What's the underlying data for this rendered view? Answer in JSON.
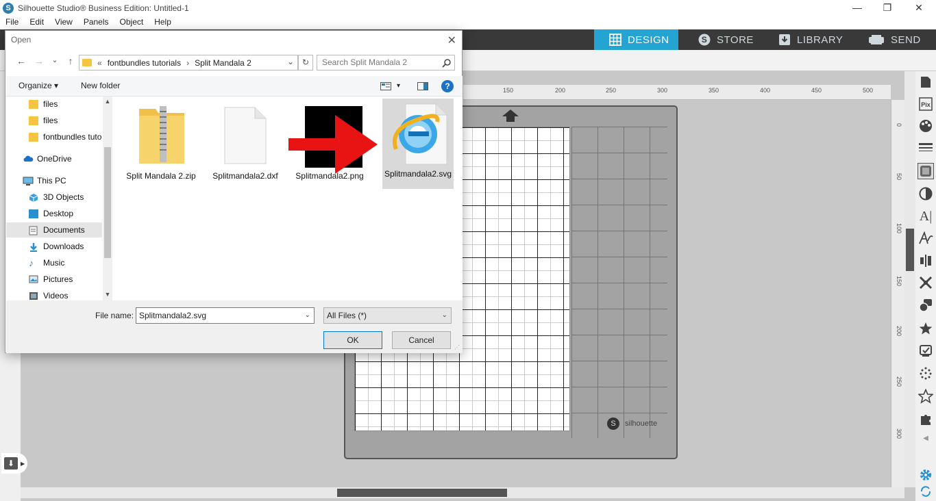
{
  "window": {
    "title": "Silhouette Studio® Business Edition: Untitled-1",
    "logo_text": "S",
    "controls": [
      "—",
      "❐",
      "✕"
    ]
  },
  "menu": [
    "File",
    "Edit",
    "View",
    "Panels",
    "Object",
    "Help"
  ],
  "nav_tabs": [
    {
      "label": "DESIGN",
      "icon": "grid-icon",
      "active": true
    },
    {
      "label": "STORE",
      "icon": "silhouette-s-icon",
      "active": false
    },
    {
      "label": "LIBRARY",
      "icon": "library-download-icon",
      "active": false
    },
    {
      "label": "SEND",
      "icon": "cutter-send-icon",
      "active": false
    }
  ],
  "ruler": {
    "h_ticks": [
      "150",
      "200",
      "250",
      "300",
      "350",
      "400",
      "450",
      "500"
    ],
    "v_ticks": [
      "0",
      "50",
      "100",
      "150",
      "200",
      "250",
      "300"
    ]
  },
  "mat": {
    "brand": "silhouette",
    "brand_logo": "S"
  },
  "dialog": {
    "title": "Open",
    "close": "✕",
    "nav_buttons": [
      "←",
      "→",
      "⌄",
      "↑"
    ],
    "breadcrumb": {
      "overflow": "«",
      "parent": "fontbundles tutorials",
      "sep": "›",
      "current": "Split Mandala 2",
      "dropdown": "⌄"
    },
    "refresh": "↻",
    "search_placeholder": "Search Split Mandala 2",
    "toolbar": {
      "organize": "Organize ▾",
      "new_folder": "New folder",
      "view_menu": "▾",
      "help": "?"
    },
    "nav_pane": [
      {
        "label": "files",
        "icon": "folder-icon",
        "indent": true,
        "selected": false
      },
      {
        "label": "files",
        "icon": "folder-icon",
        "indent": true,
        "selected": false
      },
      {
        "label": "fontbundles tuto",
        "icon": "folder-icon",
        "indent": true,
        "selected": false
      },
      {
        "label": "OneDrive",
        "icon": "onedrive-icon",
        "indent": false,
        "selected": false
      },
      {
        "label": "This PC",
        "icon": "this-pc-icon",
        "indent": false,
        "selected": false
      },
      {
        "label": "3D Objects",
        "icon": "3d-objects-icon",
        "indent": true,
        "selected": false
      },
      {
        "label": "Desktop",
        "icon": "desktop-icon",
        "indent": true,
        "selected": false
      },
      {
        "label": "Documents",
        "icon": "documents-icon",
        "indent": true,
        "selected": true
      },
      {
        "label": "Downloads",
        "icon": "downloads-icon",
        "indent": true,
        "selected": false
      },
      {
        "label": "Music",
        "icon": "music-icon",
        "indent": true,
        "selected": false
      },
      {
        "label": "Pictures",
        "icon": "pictures-icon",
        "indent": true,
        "selected": false
      },
      {
        "label": "Videos",
        "icon": "videos-icon",
        "indent": true,
        "selected": false
      }
    ],
    "files": [
      {
        "name": "Split Mandala 2.zip",
        "icon": "zip-folder-icon",
        "selected": false
      },
      {
        "name": "Splitmandala2.dxf",
        "icon": "blank-file-icon",
        "selected": false
      },
      {
        "name": "Splitmandala2.png",
        "icon": "black-image-thumbnail",
        "selected": false
      },
      {
        "name": "Splitmandala2.svg",
        "icon": "internet-explorer-icon",
        "selected": true
      }
    ],
    "filename_label": "File name:",
    "filename_value": "Splitmandala2.svg",
    "filetype_value": "All Files (*)",
    "ok_label": "OK",
    "cancel_label": "Cancel"
  },
  "colors": {
    "nav_active": "#24a4d3",
    "nav_bg": "#393939",
    "annotation_arrow": "#e81414",
    "help_blue": "#1a73c8"
  }
}
